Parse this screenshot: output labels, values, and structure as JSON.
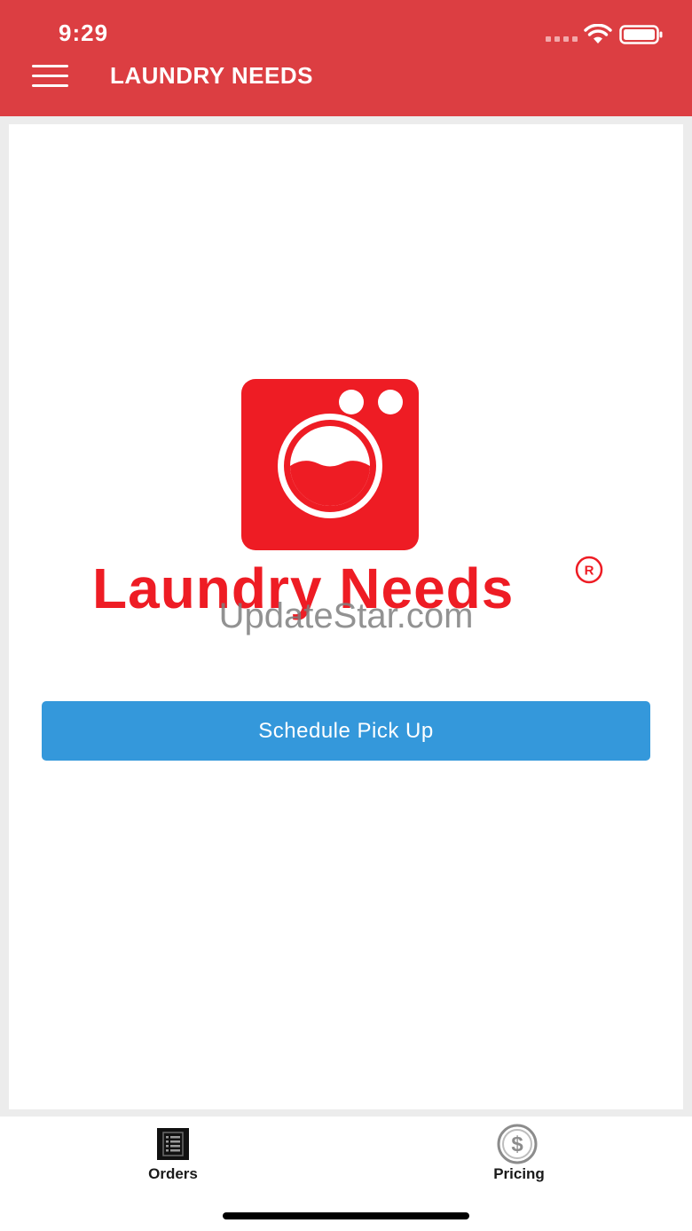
{
  "status_bar": {
    "time": "9:29"
  },
  "header": {
    "title": "LAUNDRY NEEDS",
    "menu_icon": "hamburger-menu-icon",
    "background_color": "#dc3e42"
  },
  "logo": {
    "brand_name": "Laundry Needs",
    "registered_mark": "R",
    "icon": "washing-machine-icon",
    "brand_color": "#ee1c24"
  },
  "watermark": {
    "text": "UpdateStar.com"
  },
  "main": {
    "schedule_button_label": "Schedule Pick Up",
    "button_color": "#3498db"
  },
  "tabbar": {
    "tabs": [
      {
        "label": "Orders",
        "icon": "orders-list-icon",
        "selected": true
      },
      {
        "label": "Pricing",
        "icon": "dollar-icon",
        "selected": false
      }
    ]
  }
}
